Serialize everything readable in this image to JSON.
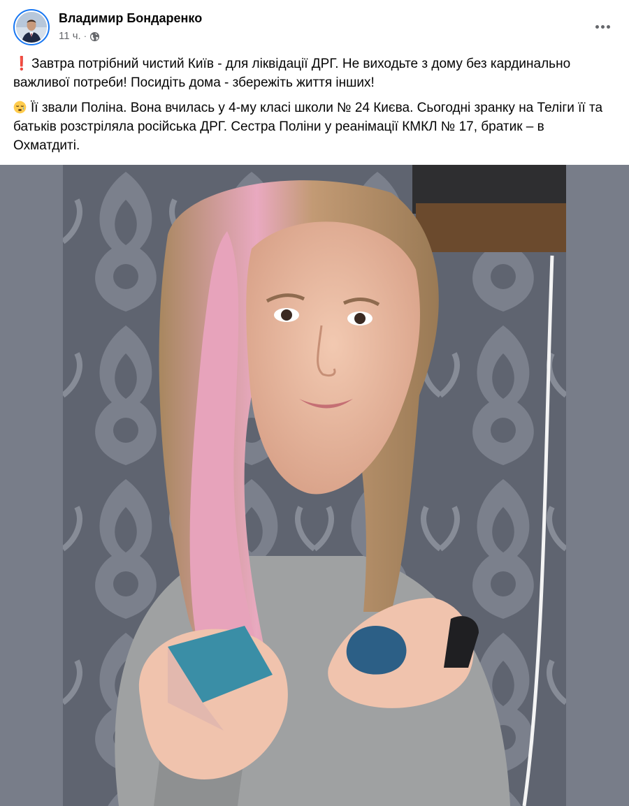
{
  "header": {
    "author_name": "Владимир Бондаренко",
    "time": "11 ч.",
    "separator": "·",
    "privacy_icon": "globe-icon",
    "more_icon": "more-horizontal-icon"
  },
  "post": {
    "paragraph_1": {
      "emoji": "❗",
      "text": "Завтра потрібний чистий Київ - для ліквідації ДРГ. Не виходьте з дому без кардинально важливої потреби! Посидіть дома - збережіть життя інших!"
    },
    "paragraph_2": {
      "emoji": "😪",
      "text": "Її звали Поліна. Вона вчилась у 4-му класі школи № 24 Києва. Сьогодні зранку на Теліги її та батьків розстріляла російська ДРГ. Сестра Поліни у реанімації КМКЛ № 17, братик – в Охматдиті."
    }
  },
  "photo": {
    "background_color": "#787d89"
  }
}
